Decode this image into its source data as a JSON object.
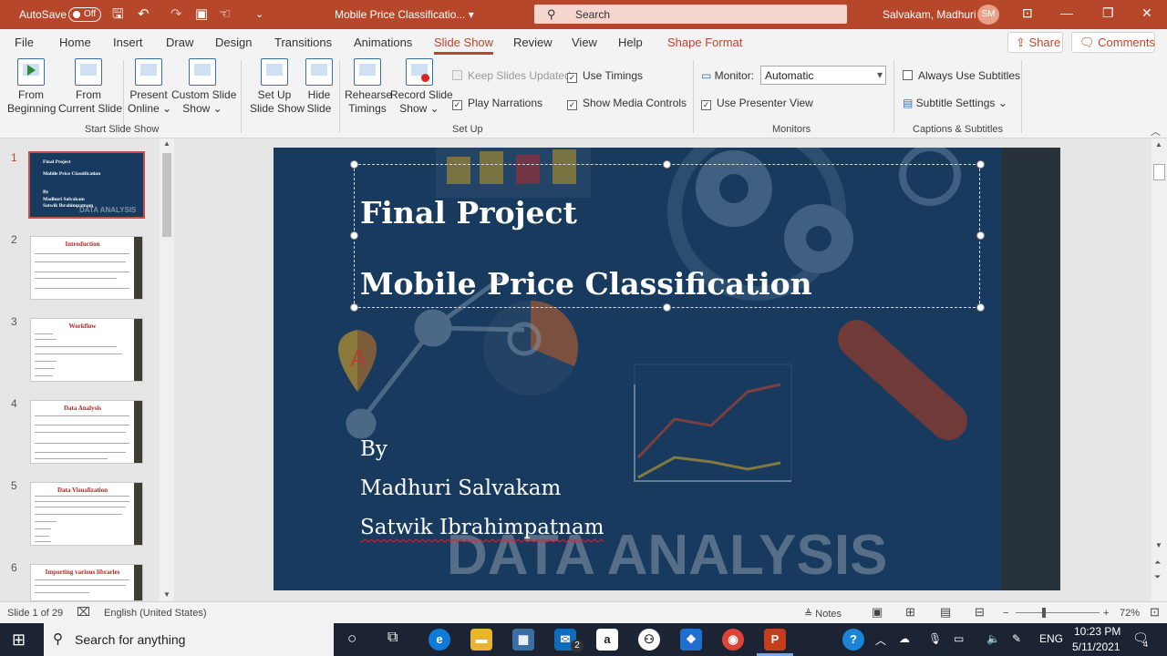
{
  "titlebar": {
    "autosave_label": "AutoSave",
    "autosave_state": "Off",
    "doc_title": "Mobile Price Classificatio...",
    "doc_caret": "▾",
    "search_placeholder": "Search",
    "user_name": "Salvakam, Madhuri",
    "user_initials": "SM"
  },
  "tabs": [
    "File",
    "Home",
    "Insert",
    "Draw",
    "Design",
    "Transitions",
    "Animations",
    "Slide Show",
    "Review",
    "View",
    "Help",
    "Shape Format"
  ],
  "active_tab": "Slide Show",
  "share_label": "Share",
  "comments_label": "Comments",
  "ribbon": {
    "start": {
      "from_beginning": [
        "From",
        "Beginning"
      ],
      "from_current": [
        "From",
        "Current Slide"
      ],
      "present_online": [
        "Present",
        "Online ⌄"
      ],
      "custom_show": [
        "Custom Slide",
        "Show ⌄"
      ],
      "group": "Start Slide Show"
    },
    "setup": {
      "setup_show": [
        "Set Up",
        "Slide Show"
      ],
      "hide_slide": [
        "Hide",
        "Slide"
      ],
      "rehearse": [
        "Rehearse",
        "Timings"
      ],
      "record": [
        "Record Slide",
        "Show ⌄"
      ],
      "keep_updated": "Keep Slides Updated",
      "use_timings": "Use Timings",
      "play_narrations": "Play Narrations",
      "show_media": "Show Media Controls",
      "group": "Set Up"
    },
    "monitors": {
      "monitor_label": "Monitor:",
      "monitor_value": "Automatic",
      "presenter_view": "Use Presenter View",
      "group": "Monitors"
    },
    "captions": {
      "always_subtitles": "Always Use Subtitles",
      "subtitle_settings": "Subtitle Settings ⌄",
      "group": "Captions & Subtitles"
    }
  },
  "thumbnails": [
    {
      "num": "1",
      "lines": [
        "Final Project",
        "Mobile Price Classification",
        "By",
        "Madhuri Salvakam",
        "Satwik Ibrahimpatnam"
      ],
      "tag": "DATA ANALYSIS"
    },
    {
      "num": "2",
      "title": "Introduction"
    },
    {
      "num": "3",
      "title": "Workflow"
    },
    {
      "num": "4",
      "title": "Data Analysis"
    },
    {
      "num": "5",
      "title": "Data Visualization"
    },
    {
      "num": "6",
      "title": "Importing various libraries"
    }
  ],
  "slide": {
    "title1": "Final Project",
    "title2": "Mobile Price Classification",
    "by": "By",
    "author1": "Madhuri Salvakam",
    "author2": "Satwik Ibrahimpatnam",
    "bg_text": "DATA ANALYSIS",
    "map_pin_letter": "A"
  },
  "status": {
    "slide_info": "Slide 1 of 29",
    "language": "English (United States)",
    "notes": "Notes",
    "zoom": "72%"
  },
  "taskbar": {
    "search": "Search for anything",
    "time": "10:23 PM",
    "date": "5/11/2021",
    "lang": "ENG",
    "mail_badge": "2",
    "notif_count": "4"
  },
  "colors": {
    "accent": "#b7472a",
    "slide_bg": "#173a5e"
  }
}
